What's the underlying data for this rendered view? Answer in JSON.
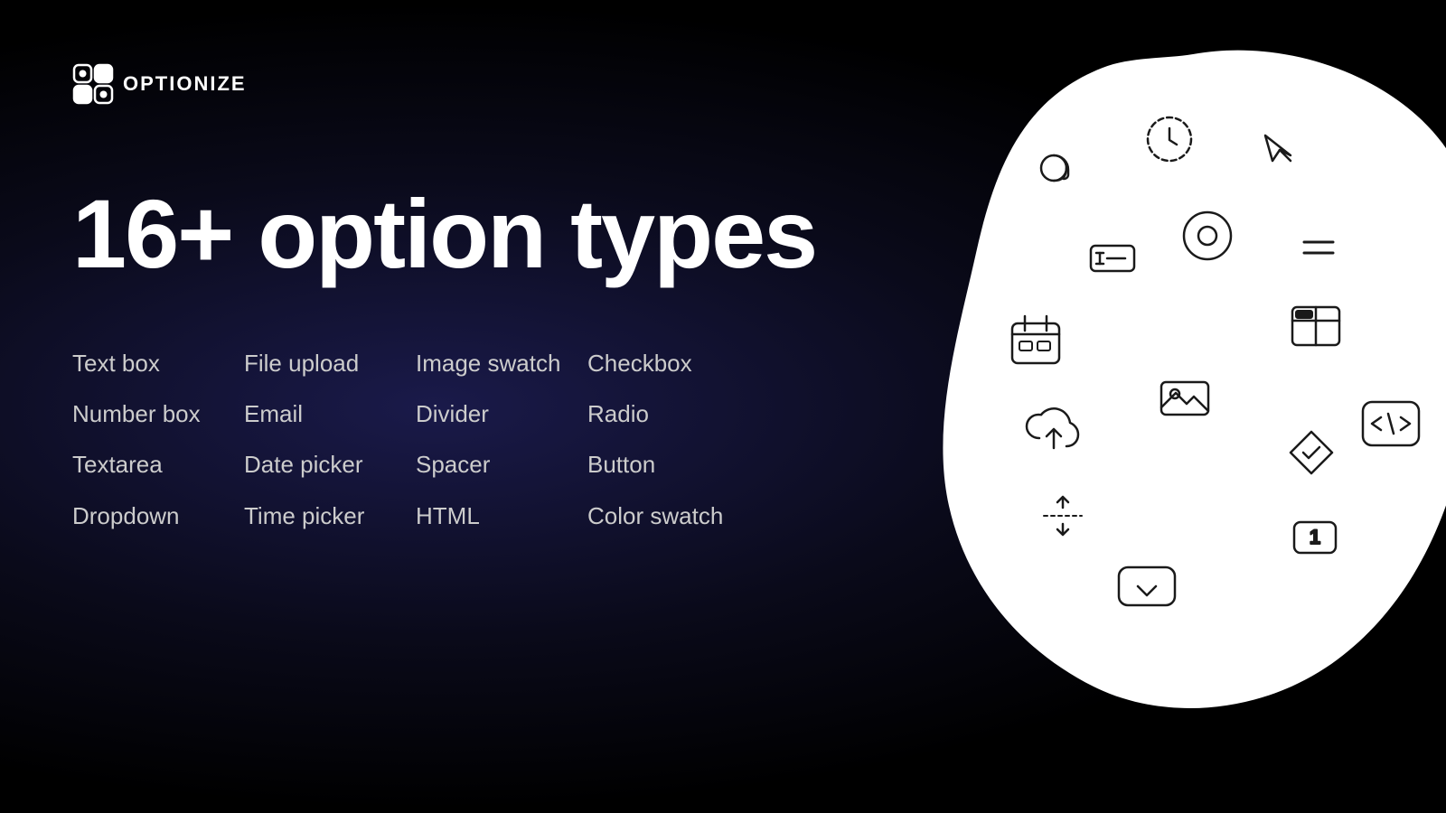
{
  "brand": {
    "name": "OPTIONIZE"
  },
  "heading": {
    "title": "16+ option types"
  },
  "features": {
    "col1": [
      "Text box",
      "Number box",
      "Textarea",
      "Dropdown"
    ],
    "col2": [
      "File upload",
      "Email",
      "Date picker",
      "Time picker"
    ],
    "col3": [
      "Image swatch",
      "Divider",
      "Spacer",
      "HTML"
    ],
    "col4": [
      "Checkbox",
      "Radio",
      "Button",
      "Color swatch"
    ]
  }
}
